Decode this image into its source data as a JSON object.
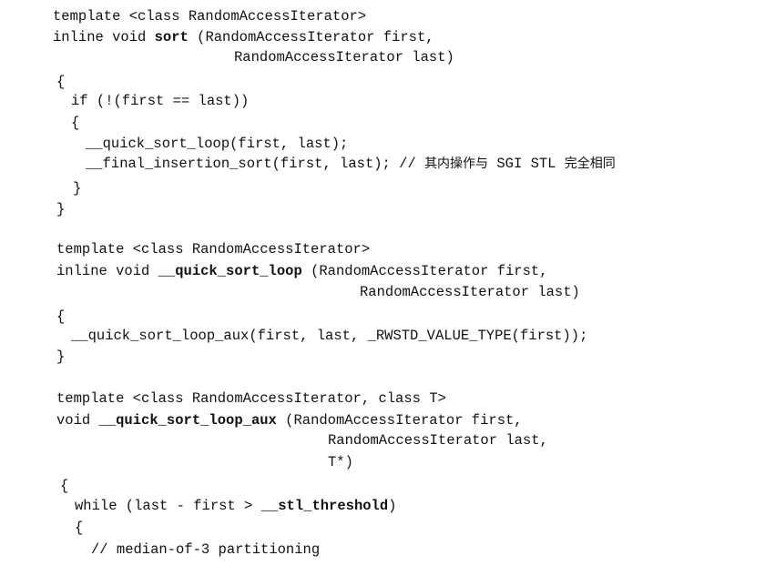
{
  "code_lines": [
    {
      "segments": [
        {
          "text": "template <class RandomAccessIterator>"
        }
      ]
    },
    {
      "segments": [
        {
          "text": "inline void "
        },
        {
          "text": "sort",
          "bold": true
        },
        {
          "text": " (RandomAccessIterator first,"
        }
      ]
    },
    {
      "segments": [
        {
          "text": "RandomAccessIterator last)"
        }
      ]
    },
    {
      "segments": [
        {
          "text": "{"
        }
      ]
    },
    {
      "segments": [
        {
          "text": "if (!(first == last))"
        }
      ]
    },
    {
      "segments": [
        {
          "text": "{"
        }
      ]
    },
    {
      "segments": [
        {
          "text": "__quick_sort_loop(first, last);"
        }
      ]
    },
    {
      "segments": [
        {
          "text": "__final_insertion_sort(first, last); // "
        },
        {
          "text": "其内操作与",
          "cjk": true
        },
        {
          "text": " SGI STL "
        },
        {
          "text": "完全相同",
          "cjk": true
        }
      ]
    },
    {
      "segments": [
        {
          "text": "}"
        }
      ]
    },
    {
      "segments": [
        {
          "text": "}"
        }
      ]
    },
    {
      "segments": [
        {
          "text": "template <class RandomAccessIterator>"
        }
      ]
    },
    {
      "segments": [
        {
          "text": "inline void "
        },
        {
          "text": "__quick_sort_loop",
          "bold": true
        },
        {
          "text": " (RandomAccessIterator first,"
        }
      ]
    },
    {
      "segments": [
        {
          "text": "RandomAccessIterator last)"
        }
      ]
    },
    {
      "segments": [
        {
          "text": "{"
        }
      ]
    },
    {
      "segments": [
        {
          "text": "__quick_sort_loop_aux(first, last, _RWSTD_VALUE_TYPE(first));"
        }
      ]
    },
    {
      "segments": [
        {
          "text": "}"
        }
      ]
    },
    {
      "segments": [
        {
          "text": "template <class RandomAccessIterator, class T>"
        }
      ]
    },
    {
      "segments": [
        {
          "text": "void "
        },
        {
          "text": "__quick_sort_loop_aux",
          "bold": true
        },
        {
          "text": " (RandomAccessIterator first,"
        }
      ]
    },
    {
      "segments": [
        {
          "text": "RandomAccessIterator last,"
        }
      ]
    },
    {
      "segments": [
        {
          "text": "T*)"
        }
      ]
    },
    {
      "segments": [
        {
          "text": "{"
        }
      ]
    },
    {
      "segments": [
        {
          "text": "while (last - first > "
        },
        {
          "text": "__stl_threshold",
          "bold": true
        },
        {
          "text": ")"
        }
      ]
    },
    {
      "segments": [
        {
          "text": "{"
        }
      ]
    },
    {
      "segments": [
        {
          "text": "// median-of-3 partitioning"
        }
      ]
    }
  ]
}
